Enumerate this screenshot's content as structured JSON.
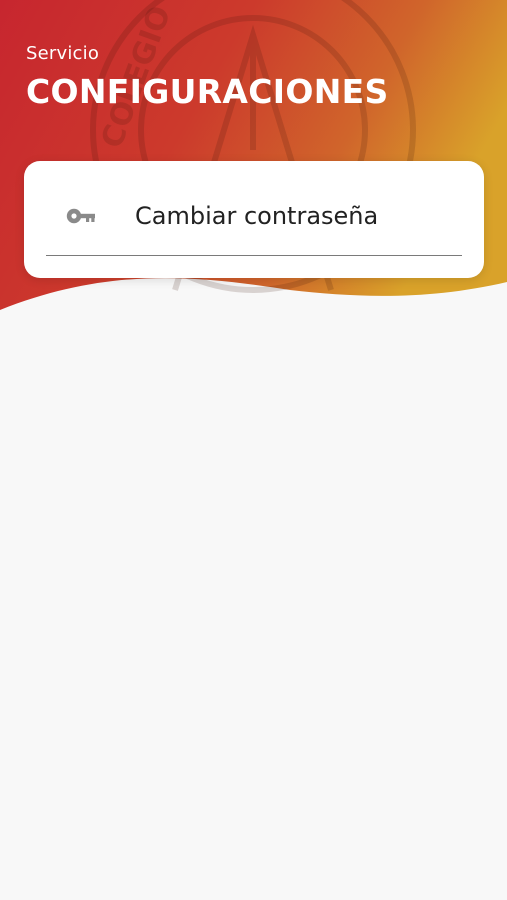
{
  "header": {
    "subtitle": "Servicio",
    "title": "CONFIGURACIONES",
    "emblem_text": "COLEGIO DE INGENIEROS DEL"
  },
  "settings": {
    "items": [
      {
        "label": "Cambiar contraseña",
        "icon": "key-icon"
      }
    ]
  },
  "colors": {
    "header_gradient_start": "#c7262f",
    "header_gradient_mid": "#cf4a2b",
    "header_gradient_end": "#d79a2a",
    "background": "#f8f8f8",
    "card": "#ffffff",
    "text_primary": "#222222",
    "icon": "#8a8a8a"
  }
}
